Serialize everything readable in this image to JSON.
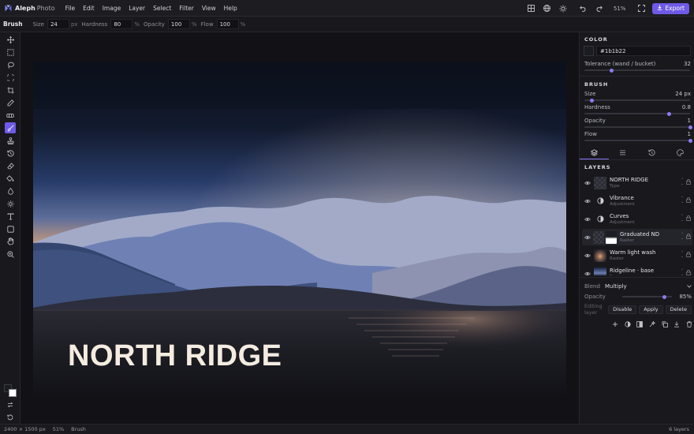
{
  "app": {
    "name": "Aleph",
    "subname": "Photo"
  },
  "menu": [
    "File",
    "Edit",
    "Image",
    "Layer",
    "Select",
    "Filter",
    "View",
    "Help"
  ],
  "header_right": {
    "zoom": "51%",
    "export_label": "Export"
  },
  "options_bar": {
    "tool": "Brush",
    "size_label": "Size",
    "size_value": "24",
    "size_unit": "px",
    "hardness_label": "Hardness",
    "hardness_value": "80",
    "hardness_unit": "%",
    "opacity_label": "Opacity",
    "opacity_value": "100",
    "opacity_unit": "%",
    "flow_label": "Flow",
    "flow_value": "100",
    "flow_unit": "%"
  },
  "tools": [
    "move-icon",
    "marquee-icon",
    "lasso-icon",
    "magic-select-icon",
    "crop-icon",
    "eyedropper-icon",
    "healing-icon",
    "brush-icon",
    "stamp-icon",
    "history-brush-icon",
    "eraser-icon",
    "fill-icon",
    "blur-icon",
    "dodge-icon",
    "type-icon",
    "shape-icon",
    "hand-icon",
    "zoom-icon"
  ],
  "active_tool": "brush-icon",
  "canvas": {
    "title_text": "NORTH RIDGE"
  },
  "colors": {
    "accent": "#6d5ae6",
    "foreground": "#1b1b22",
    "background": "#ffffff"
  },
  "color_panel": {
    "title": "COLOR",
    "hex": "#1b1b22",
    "tolerance_label": "Tolerance (wand / bucket)",
    "tolerance_value": "32",
    "tolerance_fraction": 0.26
  },
  "brush_panel": {
    "title": "BRUSH",
    "size_label": "Size",
    "size_value": "24 px",
    "size_fraction": 0.07,
    "hardness_label": "Hardness",
    "hardness_value": "0.8",
    "hardness_fraction": 0.8,
    "opacity_label": "Opacity",
    "opacity_value": "1",
    "opacity_fraction": 1.0,
    "flow_label": "Flow",
    "flow_value": "1",
    "flow_fraction": 1.0
  },
  "panel_tabs": [
    "layers-icon",
    "list-icon",
    "history-icon",
    "palette-icon"
  ],
  "layers_panel": {
    "title": "LAYERS",
    "items": [
      {
        "name": "NORTH RIDGE",
        "type": "Type",
        "thumb": "type",
        "selected": false
      },
      {
        "name": "Vibrance",
        "type": "Adjustment",
        "thumb": "adj",
        "selected": false
      },
      {
        "name": "Curves",
        "type": "Adjustment",
        "thumb": "adj",
        "selected": false
      },
      {
        "name": "Graduated ND",
        "type": "Raster",
        "thumb": "grad",
        "selected": true
      },
      {
        "name": "Warm light wash",
        "type": "Raster",
        "thumb": "warm",
        "selected": false
      },
      {
        "name": "Ridgeline · base",
        "type": "Raster",
        "thumb": "ridge",
        "selected": false
      }
    ],
    "blend_label": "Blend",
    "blend_value": "Multiply",
    "opacity_label": "Opacity",
    "opacity_value": "85%",
    "opacity_fraction": 0.85,
    "editing_label": "Editing layer",
    "buttons": [
      "Disable",
      "Apply",
      "Delete"
    ]
  },
  "status": {
    "dimensions": "2400 × 1500 px",
    "zoom": "51%",
    "tool": "Brush",
    "layers_count": "6 layers"
  }
}
